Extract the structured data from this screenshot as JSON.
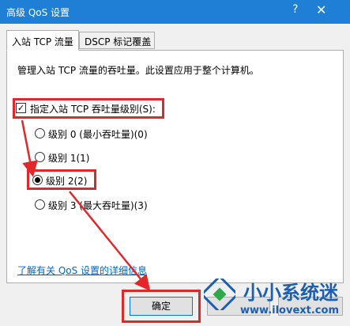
{
  "window": {
    "title": "高级 QoS 设置",
    "help_glyph": "?",
    "close_glyph": "✕"
  },
  "tabs": [
    {
      "label": "入站 TCP 流量",
      "active": true
    },
    {
      "label": "DSCP 标记覆盖",
      "active": false
    }
  ],
  "panel": {
    "description": "管理入站 TCP 流量的吞吐量。此设置应用于整个计算机。",
    "checkbox": {
      "label": "指定入站 TCP 吞吐量级别(S):",
      "checked": true,
      "glyph": "✓"
    },
    "radios": [
      {
        "label": "级别 0 (最小吞吐量)(0)",
        "selected": false
      },
      {
        "label": "级别 1(1)",
        "selected": false
      },
      {
        "label": "级别 2(2)",
        "selected": true
      },
      {
        "label": "级别 3 (最大吞吐量)(3)",
        "selected": false
      }
    ],
    "link": "了解有关 QoS 设置的详细信息"
  },
  "buttons": {
    "ok": "确定",
    "cancel": "",
    "apply": ""
  },
  "watermark": {
    "name": "小小系统迷",
    "url": "www.ilovext.com"
  },
  "colors": {
    "titlebar": "#1f7fd4",
    "highlight": "#e0282b",
    "link": "#0066cc",
    "watermark": "#1a5fb4"
  }
}
